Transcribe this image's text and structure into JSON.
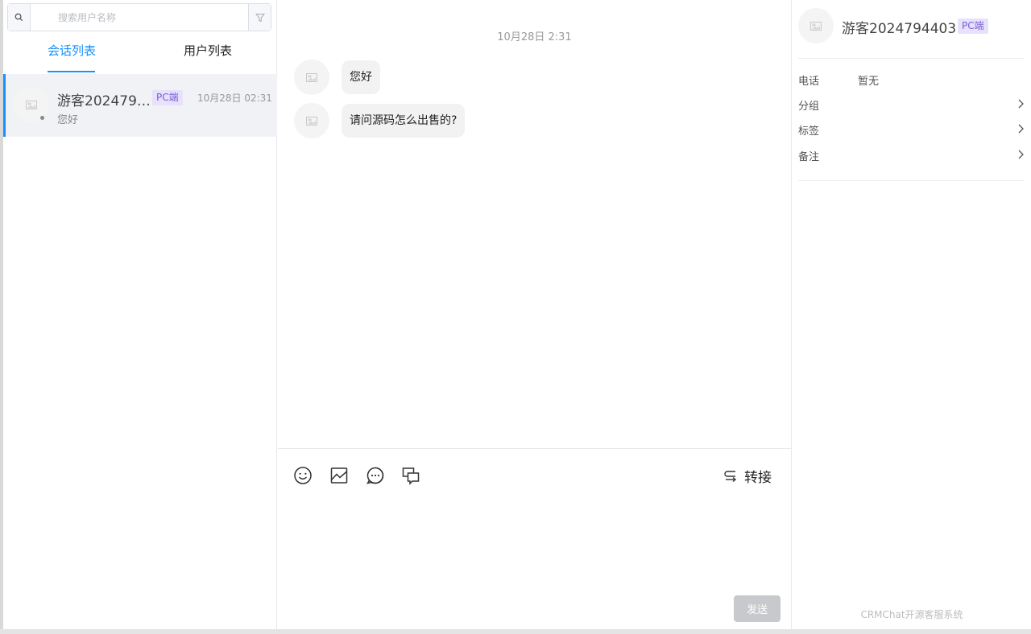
{
  "search": {
    "placeholder": "搜索用户名称"
  },
  "tabs": [
    {
      "label": "会话列表",
      "active": true
    },
    {
      "label": "用户列表",
      "active": false
    }
  ],
  "conversations": [
    {
      "name": "游客2024794403",
      "badge": "PC端",
      "time": "10月28日 02:31",
      "preview": "您好",
      "status": "offline"
    }
  ],
  "chat": {
    "date_separator": "10月28日 2:31",
    "messages": [
      {
        "text": "您好"
      },
      {
        "text": "请问源码怎么出售的?"
      }
    ],
    "toolbar": {
      "icons": [
        "emoji-icon",
        "image-icon",
        "quick-reply-icon",
        "history-icon"
      ],
      "transfer_label": "转接"
    },
    "send_label": "发送"
  },
  "profile": {
    "name": "游客2024794403",
    "badge": "PC端",
    "fields": [
      {
        "label": "电话",
        "value": "暂无"
      },
      {
        "label": "分组",
        "value": ""
      },
      {
        "label": "标签",
        "value": ""
      },
      {
        "label": "备注",
        "value": ""
      }
    ],
    "footer": "CRMChat开源客服系统"
  },
  "colors": {
    "accent": "#1890ff",
    "badge_bg": "#e7e1fb",
    "badge_text": "#7a5cd6",
    "send_disabled": "#c8c9cc"
  }
}
